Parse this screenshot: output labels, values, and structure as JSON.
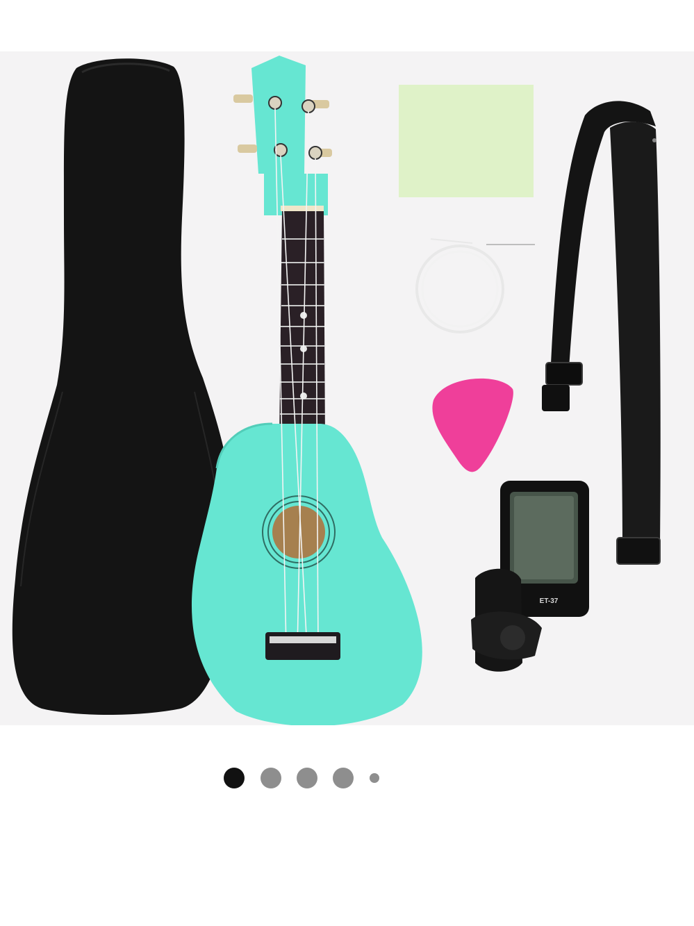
{
  "gallery": {
    "active_index": 0,
    "slide_count": 5,
    "colors": {
      "active_dot": "#111111",
      "inactive_dot": "#8e8e8e",
      "image_background": "#f4f3f4",
      "ukulele": "#66e6d2",
      "pick": "#ef3f9a",
      "cloth": "#dff2c8"
    }
  },
  "product": {
    "tuner_label": "ET-37"
  }
}
